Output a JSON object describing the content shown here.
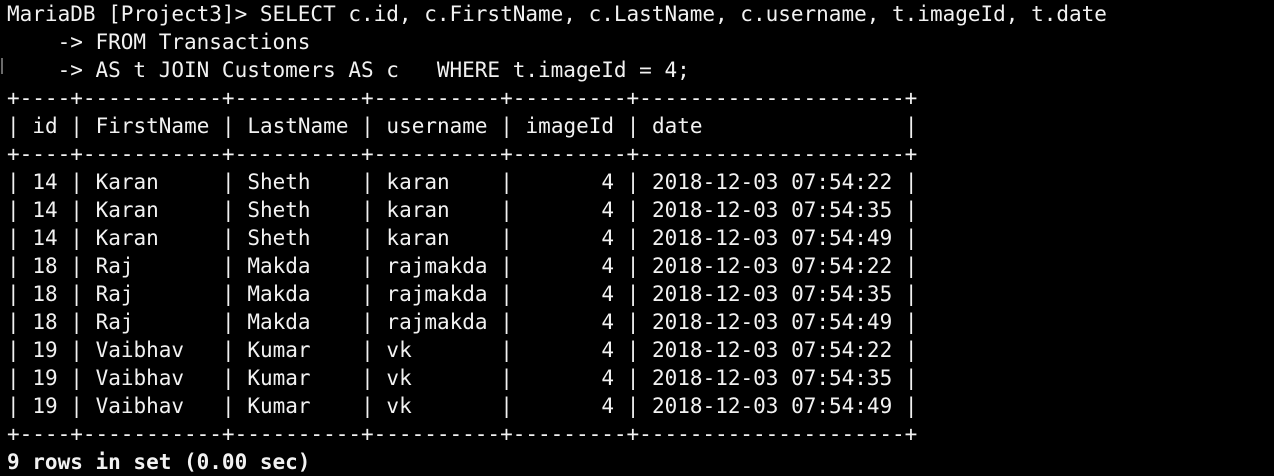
{
  "prompt": {
    "first": "MariaDB [Project3]> SELECT c.id, c.FirstName, c.LastName, c.username, t.imageId, t.date",
    "continuations": [
      "    -> FROM Transactions",
      "    -> AS t JOIN Customers AS c   WHERE t.imageId = 4;"
    ]
  },
  "table": {
    "columns": [
      {
        "name": "id",
        "align": "right"
      },
      {
        "name": "FirstName",
        "align": "left"
      },
      {
        "name": "LastName",
        "align": "left"
      },
      {
        "name": "username",
        "align": "left"
      },
      {
        "name": "imageId",
        "align": "right"
      },
      {
        "name": "date",
        "align": "left"
      }
    ],
    "rows": [
      [
        "14",
        "Karan",
        "Sheth",
        "karan",
        "4",
        "2018-12-03 07:54:22"
      ],
      [
        "14",
        "Karan",
        "Sheth",
        "karan",
        "4",
        "2018-12-03 07:54:35"
      ],
      [
        "14",
        "Karan",
        "Sheth",
        "karan",
        "4",
        "2018-12-03 07:54:49"
      ],
      [
        "18",
        "Raj",
        "Makda",
        "rajmakda",
        "4",
        "2018-12-03 07:54:22"
      ],
      [
        "18",
        "Raj",
        "Makda",
        "rajmakda",
        "4",
        "2018-12-03 07:54:35"
      ],
      [
        "18",
        "Raj",
        "Makda",
        "rajmakda",
        "4",
        "2018-12-03 07:54:49"
      ],
      [
        "19",
        "Vaibhav",
        "Kumar",
        "vk",
        "4",
        "2018-12-03 07:54:22"
      ],
      [
        "19",
        "Vaibhav",
        "Kumar",
        "vk",
        "4",
        "2018-12-03 07:54:35"
      ],
      [
        "19",
        "Vaibhav",
        "Kumar",
        "vk",
        "4",
        "2018-12-03 07:54:49"
      ]
    ]
  },
  "result_summary": "9 rows in set (0.00 sec)",
  "colors": {
    "background": "#000000",
    "text": "#f2f2f2"
  }
}
